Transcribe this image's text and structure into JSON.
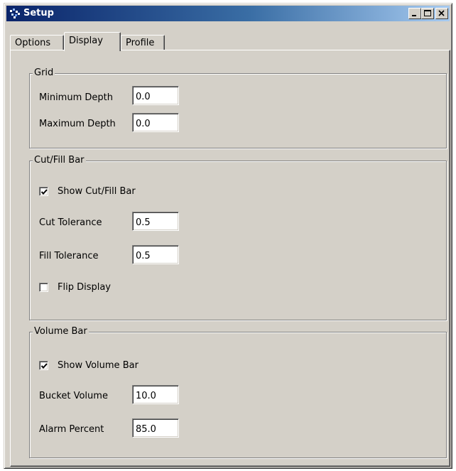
{
  "window": {
    "title": "Setup",
    "icon": "app-icon"
  },
  "title_buttons": {
    "minimize": "minimize-icon",
    "maximize": "maximize-icon",
    "close": "close-icon"
  },
  "tabs": [
    {
      "label": "Options",
      "active": false
    },
    {
      "label": "Display",
      "active": true
    },
    {
      "label": "Profile",
      "active": false
    }
  ],
  "grid": {
    "legend": "Grid",
    "min_depth_label": "Minimum Depth",
    "min_depth_value": "0.0",
    "max_depth_label": "Maximum Depth",
    "max_depth_value": "0.0"
  },
  "cutfill": {
    "legend": "Cut/Fill Bar",
    "show_label": "Show Cut/Fill Bar",
    "show_checked": true,
    "cut_tol_label": "Cut Tolerance",
    "cut_tol_value": "0.5",
    "fill_tol_label": "Fill Tolerance",
    "fill_tol_value": "0.5",
    "flip_label": "Flip Display",
    "flip_checked": false
  },
  "volume": {
    "legend": "Volume Bar",
    "show_label": "Show Volume Bar",
    "show_checked": true,
    "bucket_label": "Bucket Volume",
    "bucket_value": "10.0",
    "alarm_label": "Alarm Percent",
    "alarm_value": "85.0"
  },
  "colors": {
    "face": "#d4d0c8",
    "title_start": "#0a246a",
    "title_end": "#a6caf0"
  }
}
